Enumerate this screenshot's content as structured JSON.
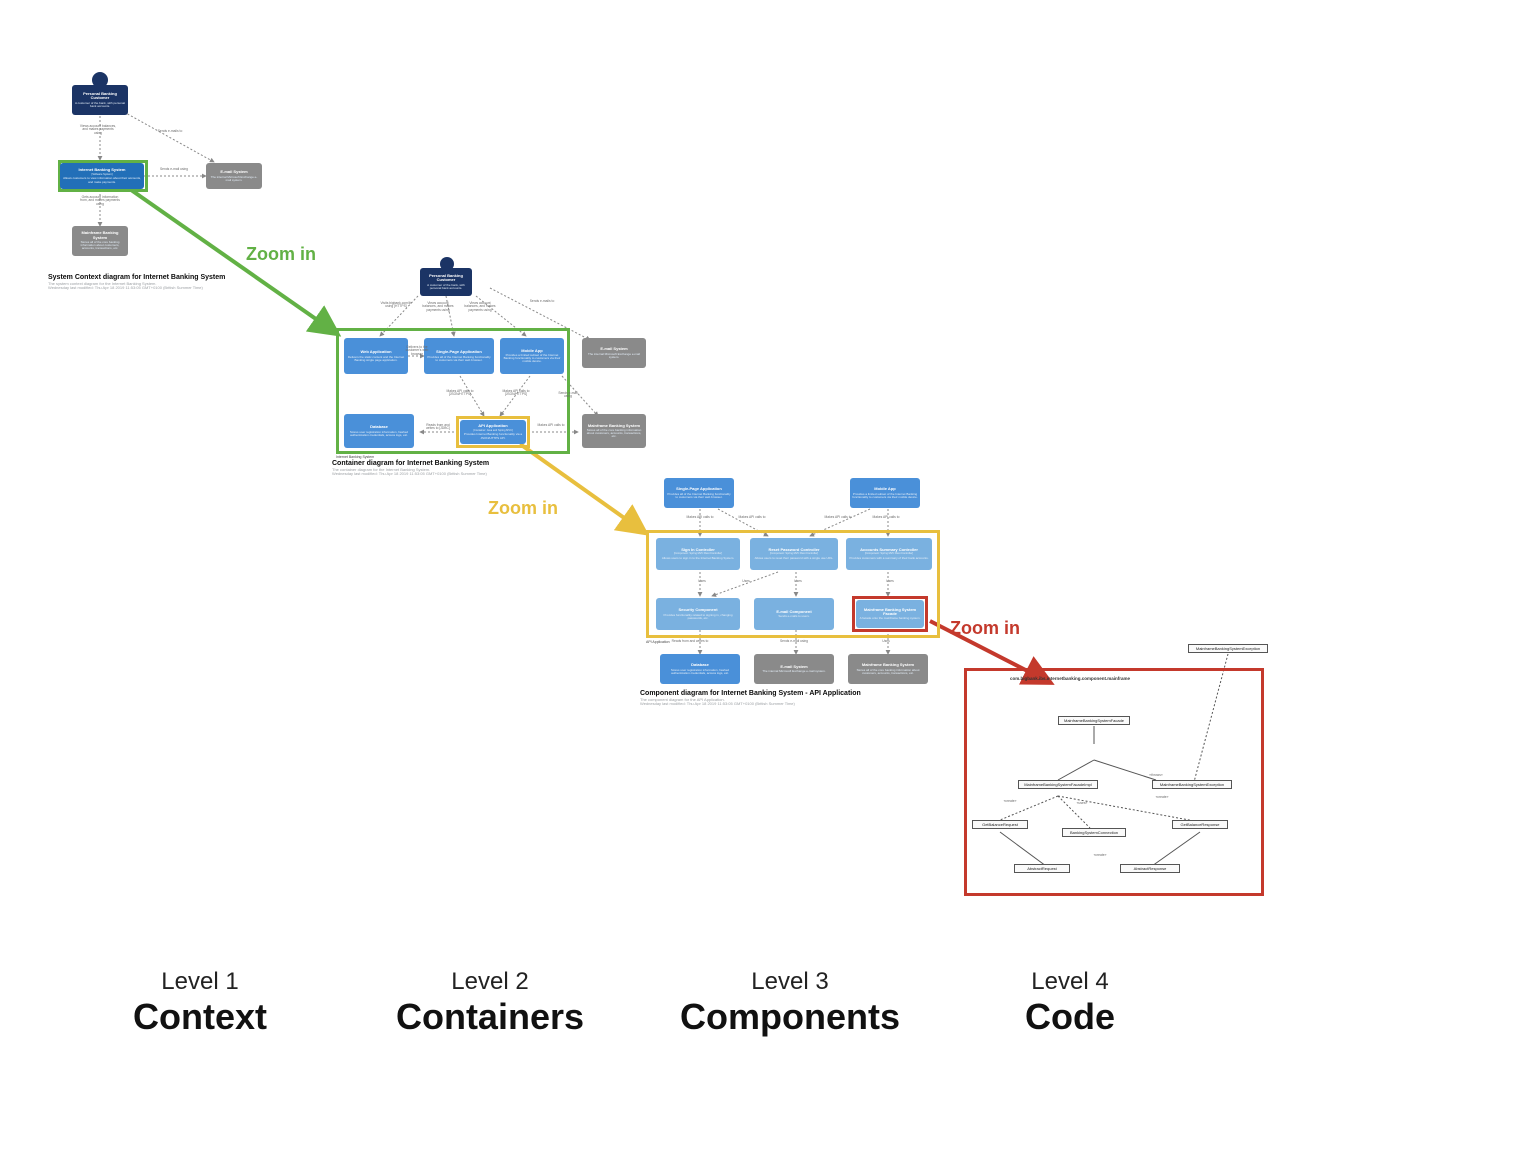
{
  "zoom_label": "Zoom in",
  "l1": {
    "person_t": "Personal Banking Customer",
    "person_d": "A customer of the bank, with personal bank accounts.",
    "ibs_t": "Internet Banking System",
    "ibs_s": "[Software System]",
    "ibs_d": "Allows customers to view information about their accounts, and make payments.",
    "email_t": "E-mail System",
    "email_s": "[Software System]",
    "email_d": "The internal Microsoft Exchange e-mail system.",
    "mf_t": "Mainframe Banking System",
    "mf_s": "[Software System]",
    "mf_d": "Stores all of the core banking information about customers, accounts, transactions, etc.",
    "e1": "Views account balances, and makes payments using",
    "e2": "Sends e-mails to",
    "e3": "Sends e-mail using",
    "e4": "Gets account information from, and makes payments using",
    "cap_t": "System Context diagram for Internet Banking System",
    "cap_d": "The system context diagram for the Internet Banking System.\nWednesday last modified: Thu Apr 18 2019 11:53:05 GMT+0100 (British Summer Time)"
  },
  "l2": {
    "person_t": "Personal Banking Customer",
    "person_d": "A customer of the bank, with personal bank accounts.",
    "web_t": "Web Application",
    "web_s": "[Container: Java and Spring MVC]",
    "web_d": "Delivers the static content and the Internet Banking single page application.",
    "spa_t": "Single-Page Application",
    "spa_s": "[Container: JavaScript and Angular]",
    "spa_d": "Provides all of the Internet Banking functionality to customers via their web browser.",
    "mob_t": "Mobile App",
    "mob_s": "[Container: Xamarin]",
    "mob_d": "Provides a limited subset of the Internet Banking functionality to customers via their mobile device.",
    "db_t": "Database",
    "db_s": "[Container: Relational Database Schema]",
    "db_d": "Stores user registration information, hashed authentication credentials, access logs, etc.",
    "api_t": "API Application",
    "api_s": "[Container: Java and Spring MVC]",
    "api_d": "Provides Internet Banking functionality via a JSON/HTTPS API.",
    "email_t": "E-mail System",
    "email_d": "The internal Microsoft Exchange e-mail system.",
    "mf_t": "Mainframe Banking System",
    "mf_d": "Stores all of the core banking information about customers, accounts, transactions, etc.",
    "e1": "Visits bigbank.com/ib using [HTTPS]",
    "e2": "Views account balances, and makes payments using",
    "e3": "Views account balances, and makes payments using",
    "e4": "Sends e-mails to",
    "e5": "Delivers to the customer's web browser",
    "e6": "Makes API calls to [JSON/HTTPS]",
    "e7": "Makes API calls to [JSON/HTTPS]",
    "e8": "Sends e-mail using",
    "e9": "Reads from and writes to [JDBC]",
    "e10": "Makes API calls to",
    "sys": "Internet Banking System",
    "cap_t": "Container diagram for Internet Banking System",
    "cap_d": "The container diagram for the Internet Banking System.\nWednesday last modified: Thu Apr 18 2019 11:53:05 GMT+0100 (British Summer Time)"
  },
  "l3": {
    "spa_t": "Single-Page Application",
    "spa_d": "Provides all of the Internet Banking functionality to customers via their web browser.",
    "mob_t": "Mobile App",
    "mob_d": "Provides a limited subset of the Internet Banking functionality to customers via their mobile device.",
    "sign_t": "Sign In Controller",
    "sign_s": "[Component: Spring MVC Rest Controller]",
    "sign_d": "Allows users to sign in to the Internet Banking System.",
    "reset_t": "Reset Password Controller",
    "reset_s": "[Component: Spring MVC Rest Controller]",
    "reset_d": "Allows users to reset their password with a single use URL.",
    "acc_t": "Accounts Summary Controller",
    "acc_s": "[Component: Spring MVC Rest Controller]",
    "acc_d": "Provides customers with a summary of their bank accounts.",
    "sec_t": "Security Component",
    "sec_s": "[Component: Spring Bean]",
    "sec_d": "Provides functionality related to signing in, changing passwords, etc.",
    "emailc_t": "E-mail Component",
    "emailc_s": "[Component: Spring Bean]",
    "emailc_d": "Sends e-mails to users.",
    "fac_t": "Mainframe Banking System Facade",
    "fac_s": "[Component: Spring Bean]",
    "fac_d": "A facade onto the mainframe banking system.",
    "db_t": "Database",
    "db_d": "Stores user registration information, hashed authentication credentials, access logs, etc.",
    "email_t": "E-mail System",
    "email_d": "The internal Microsoft Exchange e-mail system.",
    "mf_t": "Mainframe Banking System",
    "mf_d": "Stores all of the core banking information about customers, accounts, transactions, etc.",
    "e1": "Makes API calls to",
    "e2": "Makes API calls to",
    "e3": "Makes API calls to",
    "e4": "Makes API calls to",
    "e5": "Uses",
    "e6": "Uses",
    "e7": "Uses",
    "e8": "Uses",
    "e9": "Reads from and writes to",
    "e10": "Sends e-mail using",
    "e11": "Uses",
    "api": "API Application",
    "cap_t": "Component diagram for Internet Banking System - API Application",
    "cap_d": "The component diagram for the API Application.\nWednesday last modified: Thu Apr 18 2019 11:53:05 GMT+0100 (British Summer Time)"
  },
  "l4": {
    "pkg": "com.bigbank.ibs.internetbanking.component.mainframe",
    "iface": "MainframeBankingSystemFacade",
    "impl": "MainframeBankingSystemFacadeImpl",
    "exc": "MainframeBankingSystemException",
    "conn": "BankingSystemConnection",
    "gbreq": "GetBalanceRequest",
    "gbres": "GetBalanceResponse",
    "areq": "AbstractRequest",
    "ares": "AbstractResponse",
    "e1": "«throws»",
    "e2": "«create»",
    "e3": "«uses»",
    "e4": "«create»",
    "e5": "«create»"
  },
  "levels": {
    "l1n": "Level 1",
    "l1b": "Context",
    "l2n": "Level 2",
    "l2b": "Containers",
    "l3n": "Level 3",
    "l3b": "Components",
    "l4n": "Level 4",
    "l4b": "Code"
  },
  "colors": {
    "green": "#62b145",
    "yellow": "#e8bf3e",
    "red": "#c4392c",
    "person": "#1b3465",
    "sys": "#226fb8",
    "grey": "#8a8a8a",
    "container": "#4a90d9",
    "comp": "#7ab1e0"
  }
}
